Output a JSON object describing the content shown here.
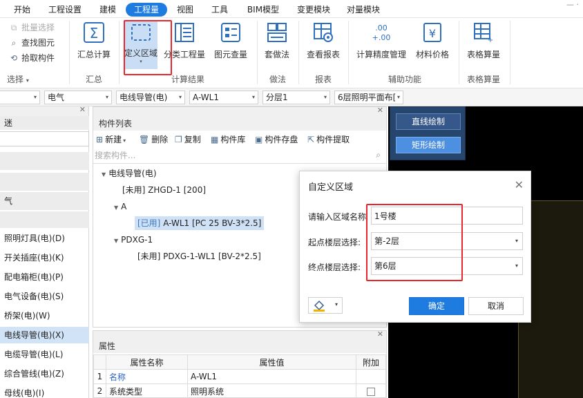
{
  "menubar": {
    "items": [
      "开始",
      "工程设置",
      "建模",
      "工程量",
      "视图",
      "工具",
      "BIM模型",
      "变更模块",
      "对量模块"
    ],
    "active_index": 3
  },
  "ribbon": {
    "select_group": {
      "batch_select": "批量选择",
      "find_element": "查找图元",
      "pick_component": "拾取构件",
      "label": "选择"
    },
    "summary": {
      "calc": "汇总计算",
      "label": "汇总"
    },
    "calc_results": {
      "define_area": "定义区域",
      "category_qty": "分类工程量",
      "element_qty": "图元查量",
      "label": "计算结果"
    },
    "method": {
      "apply": "套做法",
      "label": "做法"
    },
    "report": {
      "view": "查看报表",
      "label": "报表"
    },
    "aux": {
      "precision": "计算精度管理",
      "material_price": "材料价格",
      "label": "辅助功能"
    },
    "table": {
      "calc": "表格算量",
      "label": "表格算量"
    }
  },
  "dropbar": {
    "dd1": "",
    "dd2": "电气",
    "dd3": "电线导管(电)",
    "dd4": "A-WL1",
    "dd5": "分层1",
    "dd6": "6层照明平面布["
  },
  "left_nav": {
    "partial_top": "迷",
    "partial_qi": "气",
    "items": [
      "照明灯具(电)(D)",
      "开关插座(电)(K)",
      "配电箱柜(电)(P)",
      "电气设备(电)(S)",
      "桥架(电)(W)",
      "电线导管(电)(X)",
      "电缆导管(电)(L)",
      "综合管线(电)(Z)",
      "母线(电)(I)"
    ],
    "selected_index": 5
  },
  "component_panel": {
    "title": "构件列表",
    "tools": {
      "new": "新建",
      "delete": "删除",
      "copy": "复制",
      "library": "构件库",
      "store": "构件存盘",
      "extract": "构件提取"
    },
    "search_placeholder": "搜索构件...",
    "tree": {
      "root": "电线导管(电)",
      "zhgd": "[未用] ZHGD-1 [200]",
      "group_a": "A",
      "awl_tag": "[已用]",
      "awl_text": " A-WL1 [PC 25 BV-3*2.5]",
      "pdxg": "PDXG-1",
      "pdxg_child": "[未用] PDXG-1-WL1 [BV-2*2.5]"
    }
  },
  "properties": {
    "title": "属性",
    "headers": [
      "属性名称",
      "属性值",
      "附加"
    ],
    "rows": [
      {
        "num": "1",
        "name": "名称",
        "value": "A-WL1",
        "extra": false
      },
      {
        "num": "2",
        "name": "系统类型",
        "value": "照明系统",
        "extra": true
      }
    ]
  },
  "canvas": {
    "line_draw": "直线绘制",
    "rect_draw": "矩形绘制"
  },
  "dialog": {
    "title": "自定义区域",
    "name_label": "请输入区域名称",
    "name_value": "1号楼",
    "start_label": "起点楼层选择:",
    "start_value": "第-2层",
    "end_label": "终点楼层选择:",
    "end_value": "第6层",
    "ok": "确定",
    "cancel": "取消"
  },
  "colors": {
    "accent": "#1e7be0",
    "highlight_red": "#e8262b",
    "canvas_bg": "#000000",
    "draw_panel": "#26466e"
  }
}
